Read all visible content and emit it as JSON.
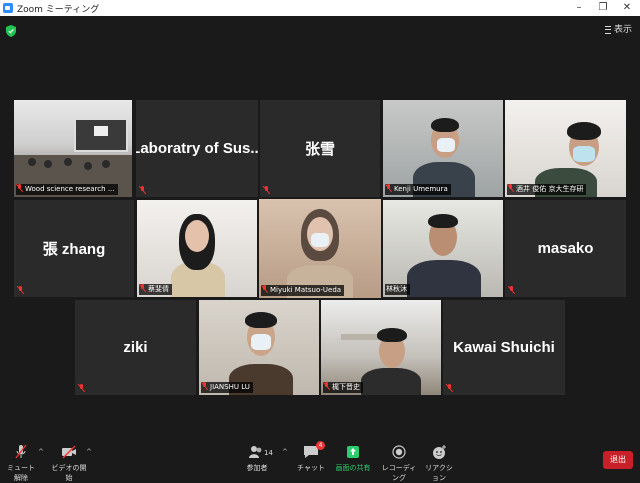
{
  "window": {
    "title": "Zoom ミーティング",
    "minimize": "–",
    "maximize": "❐",
    "close": "✕"
  },
  "header": {
    "view_label": "表示",
    "shield_icon": "shield-check-icon",
    "shield_color": "#23c552"
  },
  "tiles": [
    {
      "id": "t1",
      "type": "video",
      "scene": "classroom",
      "label": "Wood science research ..."
    },
    {
      "id": "t2",
      "type": "name",
      "display_name": "Laboratry of Sus...",
      "muted": true
    },
    {
      "id": "t3",
      "type": "name",
      "display_name": "张雪",
      "muted": true
    },
    {
      "id": "t4",
      "type": "video",
      "scene": "man-mask",
      "label": "Kenji Umemura"
    },
    {
      "id": "t5",
      "type": "video",
      "scene": "man-glasses-mask",
      "label": "酒井 俊佑 京大生存研"
    },
    {
      "id": "t6",
      "type": "name",
      "display_name": "張 zhang",
      "muted": true
    },
    {
      "id": "t7",
      "type": "video",
      "scene": "woman",
      "label": "蔡斐倩"
    },
    {
      "id": "t8",
      "type": "video",
      "scene": "woman-mask",
      "label": "Miyuki Matsuo-Ueda",
      "active": true
    },
    {
      "id": "t9",
      "type": "video",
      "scene": "man-suit",
      "label": "林秋沐"
    },
    {
      "id": "t10",
      "type": "name",
      "display_name": "masako",
      "muted": true
    },
    {
      "id": "t11",
      "type": "name",
      "display_name": "ziki",
      "muted": true
    },
    {
      "id": "t12",
      "type": "video",
      "scene": "young-man-mask",
      "label": "JIANSHU LU"
    },
    {
      "id": "t13",
      "type": "video",
      "scene": "man-glasses",
      "label": "梶下晋史"
    },
    {
      "id": "t14",
      "type": "name",
      "display_name": "Kawai Shuichi",
      "muted": true
    }
  ],
  "toolbar": {
    "mute_label": "ミュート解除",
    "video_label": "ビデオの開始",
    "participants_label": "参加者",
    "participants_count": "14",
    "chat_label": "チャット",
    "chat_badge": "4",
    "share_label": "画面の共有",
    "record_label": "レコーディング",
    "reactions_label": "リアクション",
    "leave_label": "退出",
    "caret": "^",
    "share_color": "#2dcc70",
    "leave_color": "#c91f28"
  }
}
